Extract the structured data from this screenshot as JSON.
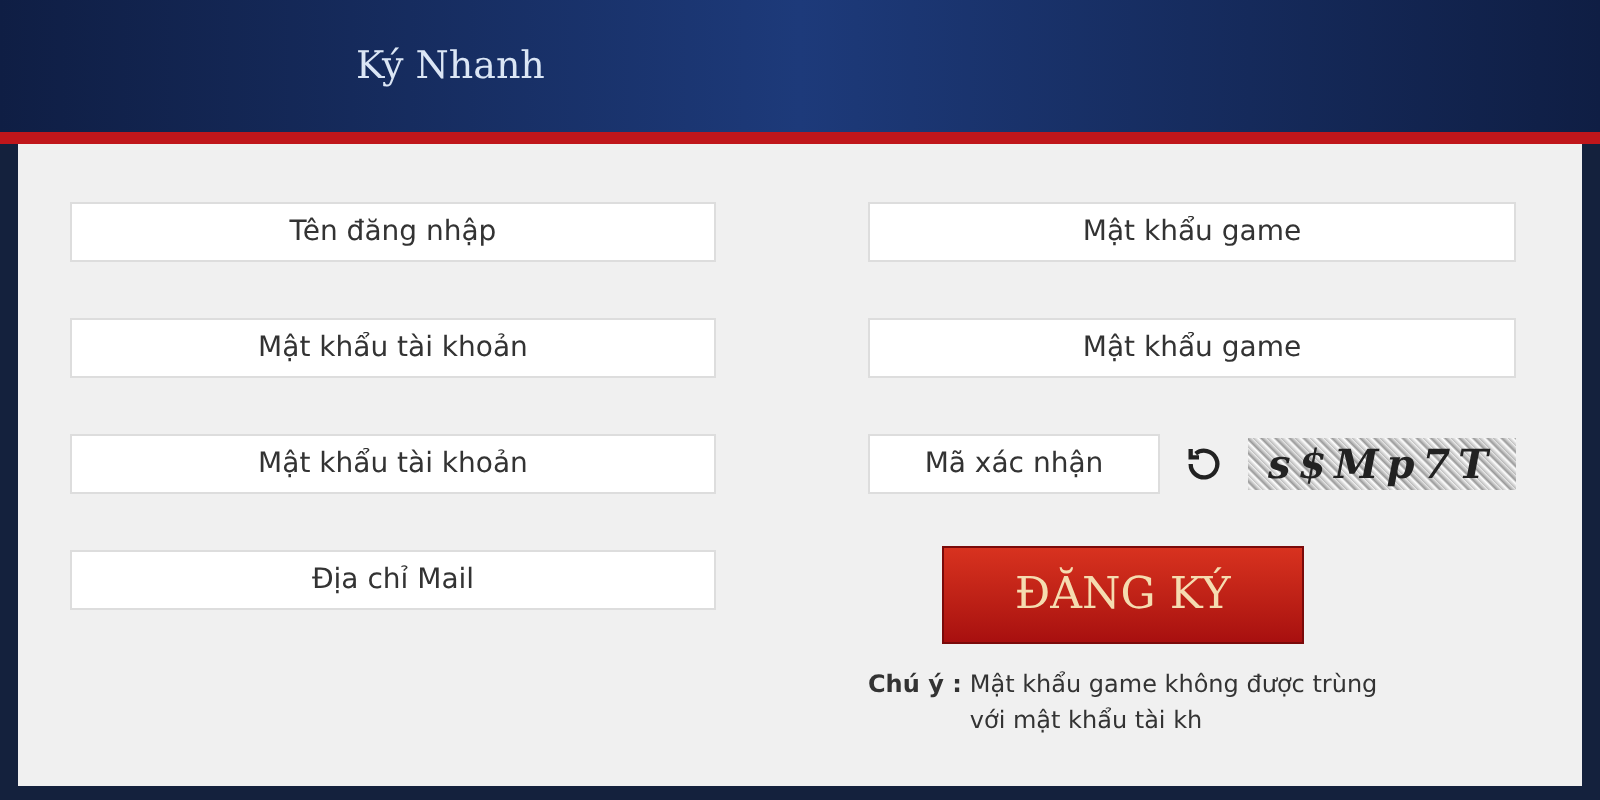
{
  "header": {
    "title": "Ký Nhanh"
  },
  "left_fields": [
    {
      "placeholder": "Tên đăng nhập"
    },
    {
      "placeholder": "Mật khẩu tài khoản"
    },
    {
      "placeholder": "Mật khẩu tài khoản"
    },
    {
      "placeholder": "Địa chỉ Mail"
    }
  ],
  "right_fields": [
    {
      "placeholder": "Mật khẩu game"
    },
    {
      "placeholder": "Mật khẩu game"
    }
  ],
  "captcha": {
    "placeholder": "Mã xác nhận",
    "code": "s$Mp7T"
  },
  "submit_button": "ĐĂNG KÝ",
  "note": {
    "label": "Chú ý :",
    "text": "Mật khẩu game không được trùng",
    "text_2": "với mật khẩu tài kh"
  }
}
